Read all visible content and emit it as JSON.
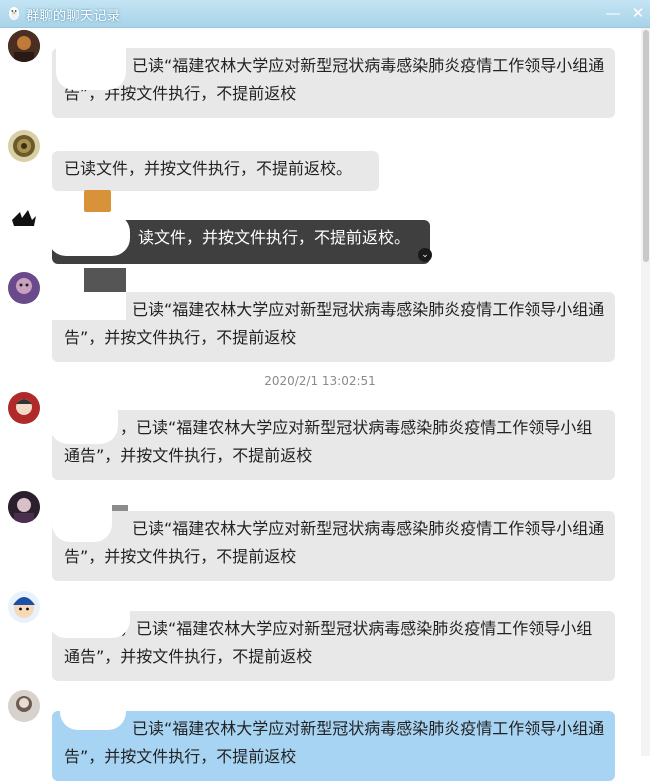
{
  "window": {
    "title": "群聊的聊天记录",
    "minimize_glyph": "—",
    "close_glyph": "✕"
  },
  "messages": [
    {
      "text": "已读“福建农林大学应对新型冠状病毒感染肺炎疫情工作领导小组通告”，并按文件执行，不提前返校"
    },
    {
      "text": "已读文件，并按文件执行，不提前返校。"
    },
    {
      "text": "读文件，并按文件执行，不提前返校。"
    },
    {
      "text": "已读“福建农林大学应对新型冠状病毒感染肺炎疫情工作领导小组通告”，并按文件执行，不提前返校"
    },
    {
      "text": "，已读“福建农林大学应对新型冠状病毒感染肺炎疫情工作领导小组通告”，并按文件执行，不提前返校"
    },
    {
      "text": "已读“福建农林大学应对新型冠状病毒感染肺炎疫情工作领导小组通告”，并按文件执行，不提前返校"
    },
    {
      "text": "，已读“福建农林大学应对新型冠状病毒感染肺炎疫情工作领导小组通告”，并按文件执行，不提前返校"
    },
    {
      "text": "已读“福建农林大学应对新型冠状病毒感染肺炎疫情工作领导小组通告”，并按文件执行，不提前返校"
    }
  ],
  "timestamp": "2020/2/1 13:02:51",
  "colors": {
    "titlebar": "#b6dcee",
    "bubble": "#e8e8e8",
    "bubble_dark": "#3f3f3f",
    "bubble_blue": "#a8d4f4"
  }
}
